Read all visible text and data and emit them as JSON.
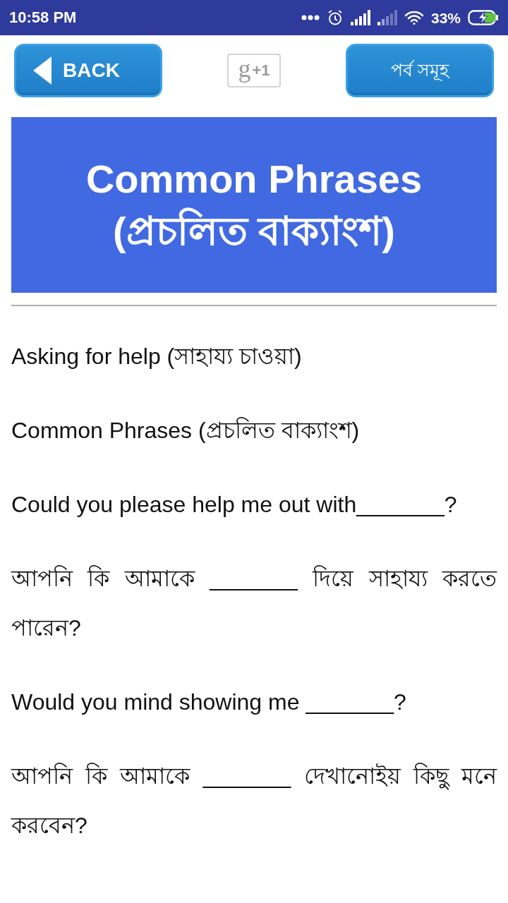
{
  "status_bar": {
    "time": "10:58 PM",
    "battery": "33%"
  },
  "toolbar": {
    "back_button": "BACK",
    "plus_one": {
      "logo": "g",
      "label": "+1"
    },
    "chapters_button": "পর্ব সমূহ"
  },
  "header": {
    "title_lines": [
      "Common Phrases",
      "(প্রচলিত বাক্যাংশ)"
    ]
  },
  "phrases": [
    {
      "text": "Asking for help (সাহায্য চাওয়া)"
    },
    {
      "text": "Common Phrases (প্রচলিত বাক্যাংশ)"
    },
    {
      "text": "Could you please help me out with_______?"
    },
    {
      "text": "আপনি কি আমাকে _______ দিয়ে সাহায্য করতে পারেন?"
    },
    {
      "text": "Would you mind showing me _______?"
    },
    {
      "text": "আপনি কি আমাকে _______ দেখানোইয় কিছু মনে করবেন?"
    }
  ]
}
